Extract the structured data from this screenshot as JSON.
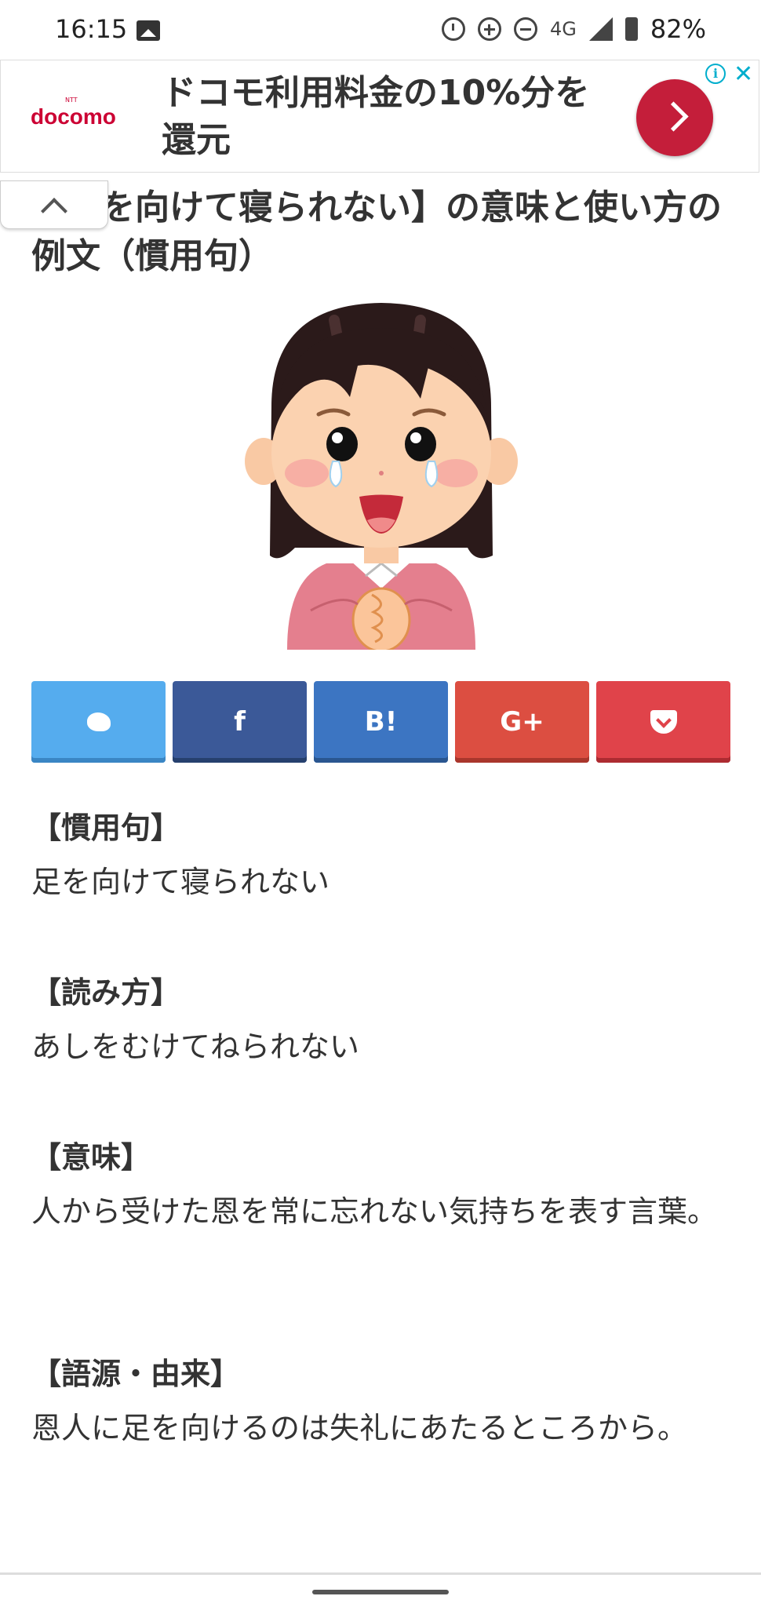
{
  "status_bar": {
    "time": "16:15",
    "network": "4G",
    "battery": "82%",
    "icons": [
      "photo-icon",
      "alarm-icon",
      "data-saver-icon",
      "dnd-icon",
      "signal-icon",
      "battery-icon"
    ]
  },
  "ad": {
    "brand": "docomo",
    "brand_small": "NTT",
    "text": "ドコモ利用料金の10%分を還元",
    "info_label": "i",
    "close_label": "✕"
  },
  "article": {
    "title": "【足を向けて寝られない】の意味と使い方の例文（慣用句）"
  },
  "share_buttons": [
    {
      "label": "",
      "icon": "twitter-icon",
      "color": "#55acee"
    },
    {
      "label": "f",
      "icon": "facebook-icon",
      "color": "#3b5998"
    },
    {
      "label": "B!",
      "icon": "hatena-icon",
      "color": "#3c75c2"
    },
    {
      "label": "G+",
      "icon": "google-plus-icon",
      "color": "#dc4e41"
    },
    {
      "label": "",
      "icon": "pocket-icon",
      "color": "#e0434a"
    }
  ],
  "sections": [
    {
      "heading": "【慣用句】",
      "body": "足を向けて寝られない"
    },
    {
      "heading": "【読み方】",
      "body": "あしをむけてねられない"
    },
    {
      "heading": "【意味】",
      "body": "人から受けた恩を常に忘れない気持ちを表す言葉。"
    },
    {
      "heading": "【語源・由来】",
      "body": "恩人に足を向けるのは失礼にあたるところから。"
    }
  ]
}
